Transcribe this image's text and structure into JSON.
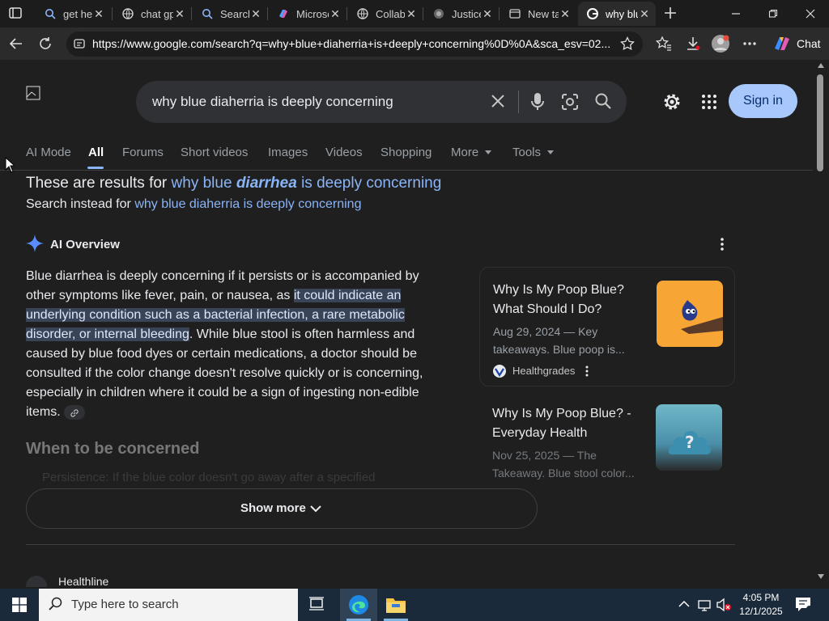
{
  "tabs": [
    {
      "label": "get help",
      "icon": "search-icon"
    },
    {
      "label": "chat gpt",
      "icon": "edge-icon"
    },
    {
      "label": "Search",
      "icon": "search-icon"
    },
    {
      "label": "Microsoft",
      "icon": "copilot-icon"
    },
    {
      "label": "Collab",
      "icon": "edge-icon"
    },
    {
      "label": "Justice",
      "icon": "globe-icon"
    },
    {
      "label": "New tab",
      "icon": "newtab-icon"
    },
    {
      "label": "why blue",
      "icon": "google-icon",
      "active": true
    }
  ],
  "address": {
    "url": "https://www.google.com/search?q=why+blue+diaherria+is+deeply+concerning%0D%0A&sca_esv=02...",
    "chat_label": "Chat"
  },
  "search": {
    "query": "why blue diaherria is deeply concerning",
    "sign_in": "Sign in"
  },
  "nav": [
    "AI Mode",
    "All",
    "Forums",
    "Short videos",
    "Images",
    "Videos",
    "Shopping",
    "More",
    "Tools"
  ],
  "correction": {
    "prefix": "These are results for",
    "corrected_pre": "why blue",
    "corrected_bold": "diarrhea",
    "corrected_post": "is deeply concerning",
    "instead_prefix": "Search instead for",
    "instead_link": "why blue diaherria is deeply concerning"
  },
  "ai_overview": {
    "label": "AI Overview",
    "text_before": "Blue diarrhea is deeply concerning if it persists or is accompanied by other symptoms like fever, pain, or nausea, as ",
    "text_highlight": "it could indicate an underlying condition such as a bacterial infection, a rare metabolic disorder, or internal bleeding",
    "text_after": ". While blue stool is often harmless and caused by blue food dyes or certain medications, a doctor should be consulted if the color change doesn't resolve quickly or is concerning, especially in children where it could be a sign of ingesting non-edible items.",
    "section_heading": "When to be concerned",
    "faded_line": "Persistence: If the blue color doesn't go away after a specified",
    "show_more": "Show more"
  },
  "cards": [
    {
      "title": "Why Is My Poop Blue? What Should I Do?",
      "meta": "Aug 29, 2024 — Key takeaways. Blue poop is...",
      "source": "Healthgrades"
    },
    {
      "title": "Why Is My Poop Blue? - Everyday Health",
      "meta": "Nov 25, 2025 — The Takeaway. Blue stool color..."
    }
  ],
  "next_result": {
    "source": "Healthline"
  },
  "taskbar": {
    "search_placeholder": "Type here to search",
    "time": "4:05 PM",
    "date": "12/1/2025"
  },
  "colors": {
    "link": "#8ab4f8",
    "signin_bg": "#a8c7fa",
    "highlight": "#394457"
  }
}
